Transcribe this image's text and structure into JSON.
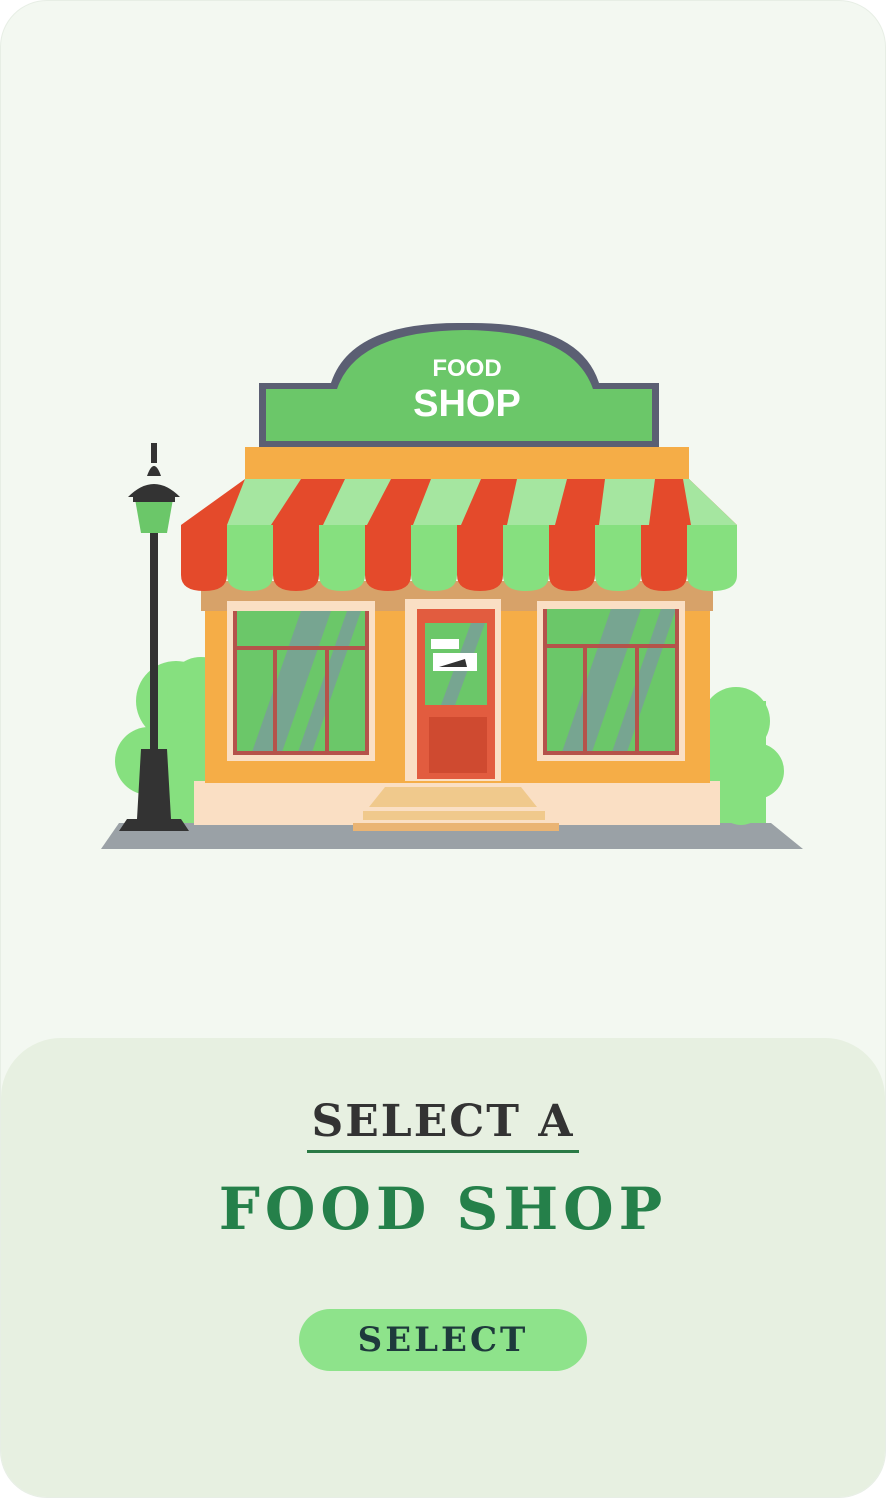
{
  "colors": {
    "background": "#f3f8f1",
    "panel": "#e7f0e1",
    "accent_green": "#25804a",
    "button": "#8ee38b",
    "button_text": "#1e3a3c",
    "awning_red": "#e44a2b",
    "awning_green": "#8ee38b",
    "wall_orange": "#f5ad47"
  },
  "illustration": {
    "sign_line1": "FOOD",
    "sign_line2": "SHOP"
  },
  "panel": {
    "title_small": "SELECT A",
    "title_large": "FOOD SHOP",
    "button_label": "SELECT"
  }
}
